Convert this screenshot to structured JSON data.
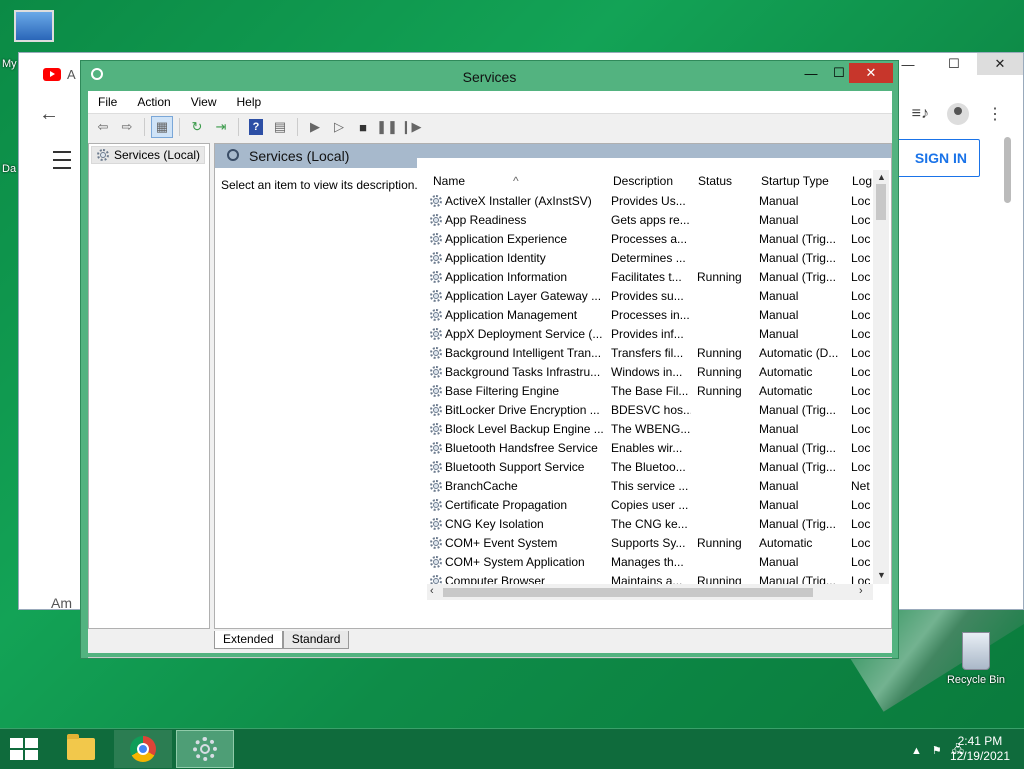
{
  "desktop": {
    "icons": [
      {
        "label": "My"
      },
      {
        "label": "Da"
      },
      {
        "label": "Recycle Bin"
      }
    ]
  },
  "browser": {
    "tab_title": "A",
    "sign_in": "SIGN IN",
    "bottom_text": "Am",
    "ctrl_min": "—",
    "ctrl_max": "☐",
    "ctrl_close": "✕"
  },
  "window": {
    "title": "Services",
    "min": "—",
    "max": "☐",
    "close": "✕",
    "menu": [
      "File",
      "Action",
      "View",
      "Help"
    ],
    "tree_node": "Services (Local)",
    "content_header": "Services (Local)",
    "description_hint": "Select an item to view its description.",
    "columns": [
      "Name",
      "Description",
      "Status",
      "Startup Type",
      "Log"
    ],
    "rows": [
      {
        "name": "ActiveX Installer (AxInstSV)",
        "desc": "Provides Us...",
        "status": "",
        "start": "Manual",
        "log": "Loc"
      },
      {
        "name": "App Readiness",
        "desc": "Gets apps re...",
        "status": "",
        "start": "Manual",
        "log": "Loc"
      },
      {
        "name": "Application Experience",
        "desc": "Processes a...",
        "status": "",
        "start": "Manual (Trig...",
        "log": "Loc"
      },
      {
        "name": "Application Identity",
        "desc": "Determines ...",
        "status": "",
        "start": "Manual (Trig...",
        "log": "Loc"
      },
      {
        "name": "Application Information",
        "desc": "Facilitates t...",
        "status": "Running",
        "start": "Manual (Trig...",
        "log": "Loc"
      },
      {
        "name": "Application Layer Gateway ...",
        "desc": "Provides su...",
        "status": "",
        "start": "Manual",
        "log": "Loc"
      },
      {
        "name": "Application Management",
        "desc": "Processes in...",
        "status": "",
        "start": "Manual",
        "log": "Loc"
      },
      {
        "name": "AppX Deployment Service (...",
        "desc": "Provides inf...",
        "status": "",
        "start": "Manual",
        "log": "Loc"
      },
      {
        "name": "Background Intelligent Tran...",
        "desc": "Transfers fil...",
        "status": "Running",
        "start": "Automatic (D...",
        "log": "Loc"
      },
      {
        "name": "Background Tasks Infrastru...",
        "desc": "Windows in...",
        "status": "Running",
        "start": "Automatic",
        "log": "Loc"
      },
      {
        "name": "Base Filtering Engine",
        "desc": "The Base Fil...",
        "status": "Running",
        "start": "Automatic",
        "log": "Loc"
      },
      {
        "name": "BitLocker Drive Encryption ...",
        "desc": "BDESVC hos...",
        "status": "",
        "start": "Manual (Trig...",
        "log": "Loc"
      },
      {
        "name": "Block Level Backup Engine ...",
        "desc": "The WBENG...",
        "status": "",
        "start": "Manual",
        "log": "Loc"
      },
      {
        "name": "Bluetooth Handsfree Service",
        "desc": "Enables wir...",
        "status": "",
        "start": "Manual (Trig...",
        "log": "Loc"
      },
      {
        "name": "Bluetooth Support Service",
        "desc": "The Bluetoo...",
        "status": "",
        "start": "Manual (Trig...",
        "log": "Loc"
      },
      {
        "name": "BranchCache",
        "desc": "This service ...",
        "status": "",
        "start": "Manual",
        "log": "Net"
      },
      {
        "name": "Certificate Propagation",
        "desc": "Copies user ...",
        "status": "",
        "start": "Manual",
        "log": "Loc"
      },
      {
        "name": "CNG Key Isolation",
        "desc": "The CNG ke...",
        "status": "",
        "start": "Manual (Trig...",
        "log": "Loc"
      },
      {
        "name": "COM+ Event System",
        "desc": "Supports Sy...",
        "status": "Running",
        "start": "Automatic",
        "log": "Loc"
      },
      {
        "name": "COM+ System Application",
        "desc": "Manages th...",
        "status": "",
        "start": "Manual",
        "log": "Loc"
      },
      {
        "name": "Computer Browser",
        "desc": "Maintains a...",
        "status": "Running",
        "start": "Manual (Trig...",
        "log": "Loc"
      }
    ],
    "tabs": [
      "Extended",
      "Standard"
    ]
  },
  "taskbar": {
    "time": "2:41 PM",
    "date": "12/19/2021",
    "tray_arrow": "▲"
  },
  "colors": {
    "accent": "#53b380",
    "close_red": "#c7362b",
    "header_band": "#a7b9cc",
    "sign_in_blue": "#1a73e8"
  }
}
